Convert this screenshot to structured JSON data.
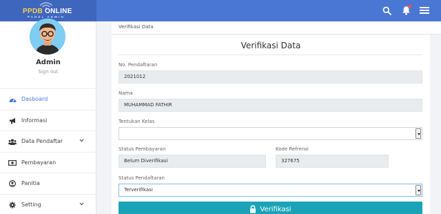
{
  "brand": {
    "title_part1": "PPDB ",
    "title_part2": "ONLINE",
    "subtitle": "PANEL ADMIN"
  },
  "user": {
    "name": "Admin",
    "sign_out": "Sign out"
  },
  "menu": [
    {
      "label": "Dasboard",
      "icon": "tachometer-icon",
      "active": true
    },
    {
      "label": "Informasi",
      "icon": "bullhorn-icon"
    },
    {
      "label": "Data Pendaftar",
      "icon": "users-icon",
      "has_submenu": true
    },
    {
      "label": "Pembayaran",
      "icon": "money-icon"
    },
    {
      "label": "Panitia",
      "icon": "user-circle-icon"
    },
    {
      "label": "Setting",
      "icon": "gear-icon",
      "has_submenu": true
    }
  ],
  "breadcrumb": "Verifikasi Data",
  "form": {
    "title": "Verifikasi Data",
    "no_pendaftaran": {
      "label": "No. Pendaftaran",
      "value": "2021012"
    },
    "nama": {
      "label": "Nama",
      "value": "MUHAMMAD FATHIR"
    },
    "kelas": {
      "label": "Tentukan Kelas",
      "value": ""
    },
    "status_pembayaran": {
      "label": "Status Pembayaran",
      "value": "Belum Diverifikasi"
    },
    "kode_referensi": {
      "label": "Kode Refrensi",
      "value": "327675"
    },
    "status_pendaftaran": {
      "label": "Status Pendaftaran",
      "value": "Terverifikasi"
    },
    "submit_label": "Verifikasi"
  },
  "colors": {
    "topbar": "#4a77d4",
    "brand_bg": "#3f66bd",
    "button": "#1aa3b7",
    "active_menu": "#4a77d4",
    "logo_yellow": "#f3d34a"
  }
}
